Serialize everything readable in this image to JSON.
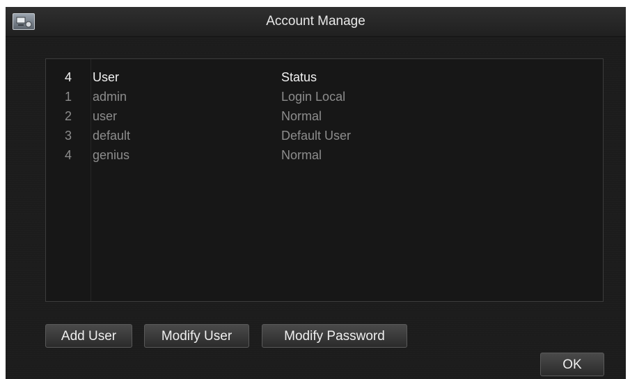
{
  "window": {
    "title": "Account Manage",
    "icon": "account-monitor-icon"
  },
  "table": {
    "header": {
      "count": "4",
      "user": "User",
      "status": "Status"
    },
    "rows": [
      {
        "index": "1",
        "user": "admin",
        "status": "Login Local"
      },
      {
        "index": "2",
        "user": "user",
        "status": "Normal"
      },
      {
        "index": "3",
        "user": "default",
        "status": "Default User"
      },
      {
        "index": "4",
        "user": "genius",
        "status": "Normal"
      }
    ]
  },
  "buttons": {
    "add_user": "Add User",
    "modify_user": "Modify User",
    "modify_password": "Modify Password",
    "ok": "OK"
  },
  "colors": {
    "background": "#1c1c1c",
    "header_text": "#f2f2f2",
    "row_text": "#8d8d8d"
  }
}
